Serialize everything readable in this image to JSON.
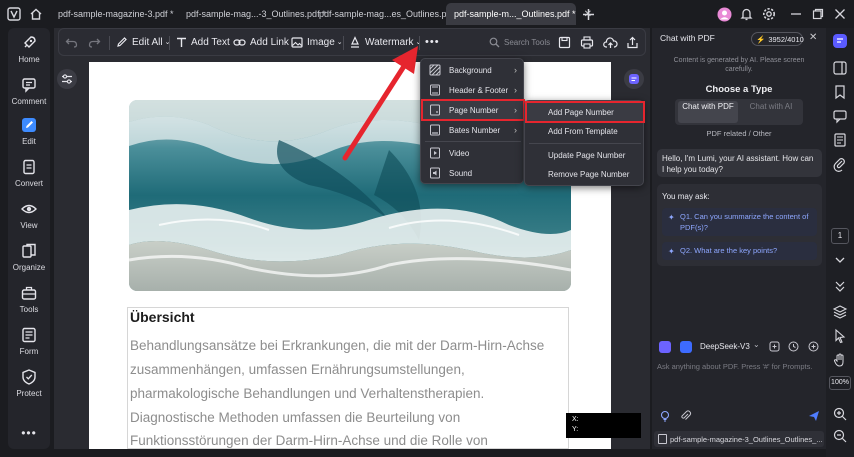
{
  "tabs": [
    {
      "label": "pdf-sample-magazine-3.pdf *",
      "active": false
    },
    {
      "label": "pdf-sample-mag...-3_Outlines.pdf *",
      "active": false
    },
    {
      "label": "pdf-sample-mag...es_Outlines.pdf *",
      "active": false
    },
    {
      "label": "pdf-sample-m..._Outlines.pdf *",
      "active": true
    }
  ],
  "sidebar": {
    "items": [
      {
        "label": "Home",
        "icon": "rocket-icon"
      },
      {
        "label": "Comment",
        "icon": "comment-icon"
      },
      {
        "label": "Edit",
        "icon": "edit-icon"
      },
      {
        "label": "Convert",
        "icon": "convert-icon"
      },
      {
        "label": "View",
        "icon": "eye-icon"
      },
      {
        "label": "Organize",
        "icon": "organize-icon"
      },
      {
        "label": "Tools",
        "icon": "toolbox-icon"
      },
      {
        "label": "Form",
        "icon": "form-icon"
      },
      {
        "label": "Protect",
        "icon": "shield-icon"
      }
    ]
  },
  "toolbar": {
    "edit_all": "Edit All",
    "add_text": "Add Text",
    "add_link": "Add Link",
    "image": "Image",
    "watermark": "Watermark",
    "search_placeholder": "Search Tools"
  },
  "menu": {
    "items": [
      "Background",
      "Header & Footer",
      "Page Number",
      "Bates Number",
      "Video",
      "Sound"
    ],
    "highlighted": "Page Number"
  },
  "submenu": {
    "items": [
      "Add Page Number",
      "Add From Template",
      "Update Page Number",
      "Remove Page Number"
    ],
    "highlighted": "Add Page Number"
  },
  "document": {
    "heading": "Übersicht",
    "lines": [
      "Behandlungsansätze bei Erkrankungen, die mit der Darm-Hirn-Achse",
      "zusammenhängen, umfassen Ernährungsumstellungen,",
      "pharmakologische Behandlungen und Verhaltenstherapien.",
      "Diagnostische Methoden umfassen die Beurteilung von",
      "Funktionsstörungen der Darm-Hirn-Achse und die Rolle von"
    ],
    "coord_x": "X:",
    "coord_y": "Y:"
  },
  "chat": {
    "title": "Chat with PDF",
    "credits": "3952/4010",
    "notice": "Content is generated by AI. Please screen carefully.",
    "choose_type": "Choose a Type",
    "type_pdf": "Chat with PDF",
    "type_ai": "Chat with AI",
    "related": "PDF related / Other",
    "greeting": "Hello, I'm Lumi, your AI assistant. How can I help you today?",
    "you_may_ask": "You may ask:",
    "q1": "Q1. Can you summarize the content of PDF(s)?",
    "q2": "Q2. What are the key points?",
    "model": "DeepSeek-V3",
    "input_placeholder": "Ask anything about PDF. Press '#' for Prompts.",
    "file_name": "pdf-sample-magazine-3_Outlines_Outlines_..."
  },
  "rightbar": {
    "page_number": "1",
    "zoom": "100%"
  },
  "colors": {
    "accent_red": "#e6252e",
    "question_blue": "#8ea7ff",
    "link_green": "#2ecc71"
  }
}
